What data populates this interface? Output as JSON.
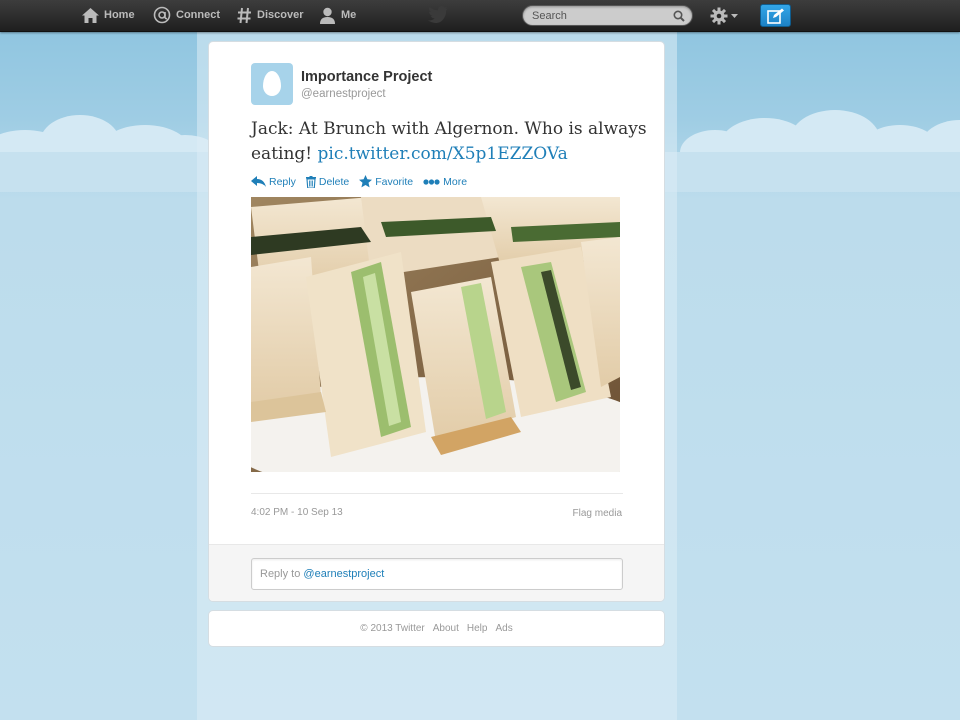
{
  "topbar": {
    "nav": [
      {
        "label": "Home",
        "icon": "home-icon"
      },
      {
        "label": "Connect",
        "icon": "at-icon"
      },
      {
        "label": "Discover",
        "icon": "hash-icon"
      },
      {
        "label": "Me",
        "icon": "person-icon"
      }
    ],
    "search_placeholder": "Search",
    "logo_icon": "twitter-bird-icon",
    "settings_icon": "gear-icon",
    "compose_icon": "compose-icon"
  },
  "tweet": {
    "name": "Importance Project",
    "handle": "@earnestproject",
    "text": "Jack: At Brunch with Algernon. Who is always eating!",
    "link": "pic.twitter.com/X5p1EZZOVa",
    "actions": [
      {
        "label": "Reply",
        "icon": "reply-icon"
      },
      {
        "label": "Delete",
        "icon": "trash-icon"
      },
      {
        "label": "Favorite",
        "icon": "star-icon"
      },
      {
        "label": "More",
        "icon": "more-icon"
      }
    ],
    "photo_alt": "photo of sandwiches",
    "timestamp": "4:02 PM - 10 Sep 13",
    "flag_label": "Flag media"
  },
  "reply": {
    "prefix": "Reply to",
    "mention": "@earnestproject"
  },
  "footer": {
    "copyright": "© 2013 Twitter",
    "links": [
      "About",
      "Help",
      "Ads"
    ]
  },
  "colors": {
    "link": "#1f7fb8",
    "topbar": "#2b2b2b",
    "compose": "#2a96d8"
  }
}
